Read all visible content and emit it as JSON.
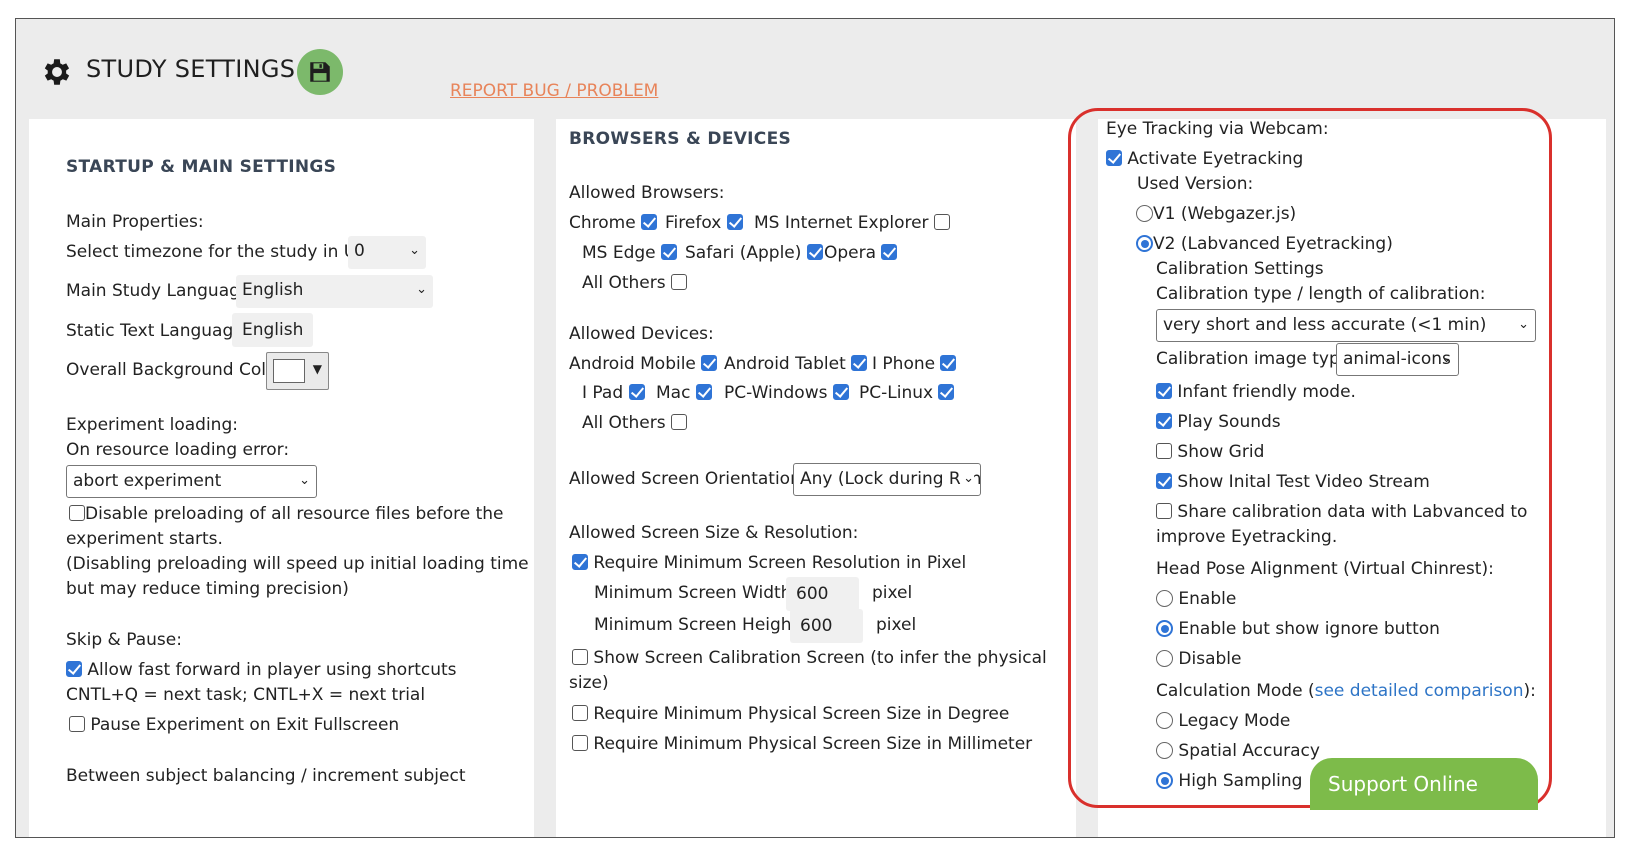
{
  "header": {
    "title": "STUDY SETTINGS",
    "report_link": "REPORT BUG / PROBLEM"
  },
  "startup": {
    "title": "STARTUP & MAIN SETTINGS",
    "main_properties_label": "Main Properties:",
    "timezone_label": "Select timezone for the study in UTC:",
    "timezone_value": "0",
    "language_label": "Main Study Language:",
    "language_value": "English",
    "static_text_label": "Static Text Language:",
    "static_text_value": "English",
    "bg_color_label": "Overall Background Color:",
    "bg_color_value": "#ffffff",
    "experiment_loading_label": "Experiment loading:",
    "resource_error_label": "On resource loading error:",
    "resource_error_value": "abort experiment",
    "disable_preload_label": "Disable preloading of all resource files before the",
    "disable_preload_label_2": "experiment starts.",
    "disable_preload_checked": false,
    "preload_note_1": "(Disabling preloading will speed up initial loading time",
    "preload_note_2": "but may reduce timing precision)",
    "skip_pause_label": "Skip & Pause:",
    "fast_forward_label": "Allow fast forward in player using shortcuts",
    "fast_forward_checked": true,
    "shortcuts_note": "CNTL+Q = next task; CNTL+X = next trial",
    "pause_exit_label": "Pause Experiment on Exit Fullscreen",
    "pause_exit_checked": false,
    "balancing_label": "Between subject balancing / increment subject"
  },
  "browsers": {
    "title": "BROWSERS & DEVICES",
    "allowed_browsers_label": "Allowed Browsers:",
    "browser_items": [
      {
        "label": "Chrome",
        "checked": true
      },
      {
        "label": "Firefox",
        "checked": true
      },
      {
        "label": "MS Internet Explorer",
        "checked": false
      },
      {
        "label": "MS Edge",
        "checked": true
      },
      {
        "label": "Safari (Apple)",
        "checked": true
      },
      {
        "label": "Opera",
        "checked": true
      },
      {
        "label": "All Others",
        "checked": false
      }
    ],
    "allowed_devices_label": "Allowed Devices:",
    "device_items": [
      {
        "label": "Android Mobile",
        "checked": true
      },
      {
        "label": "Android Tablet",
        "checked": true
      },
      {
        "label": "I Phone",
        "checked": true
      },
      {
        "label": "I Pad",
        "checked": true
      },
      {
        "label": "Mac",
        "checked": true
      },
      {
        "label": "PC-Windows",
        "checked": true
      },
      {
        "label": "PC-Linux",
        "checked": true
      },
      {
        "label": "All Others",
        "checked": false
      }
    ],
    "orientation_label": "Allowed Screen Orientations:",
    "orientation_value": "Any (Lock during Run)",
    "screen_size_label": "Allowed Screen Size & Resolution:",
    "require_min_res_label": "Require Minimum Screen Resolution in Pixel",
    "require_min_res_checked": true,
    "min_width_label": "Minimum Screen Width:",
    "min_width_value": "600",
    "min_height_label": "Minimum Screen Height:",
    "min_height_value": "600",
    "pixel_unit": "pixel",
    "show_calibration_label": "Show Screen Calibration Screen (to infer the physical",
    "show_calibration_label_2": "size)",
    "show_calibration_checked": false,
    "require_degree_label": "Require Minimum Physical Screen Size in Degree",
    "require_degree_checked": false,
    "require_mm_label": "Require Minimum Physical Screen Size in Millimeter",
    "require_mm_checked": false
  },
  "eyetracking": {
    "title": "Eye Tracking via Webcam:",
    "activate_label": "Activate Eyetracking",
    "activate_checked": true,
    "used_version_label": "Used Version:",
    "v1_label": "V1 (Webgazer.js)",
    "v1_selected": false,
    "v2_label": "V2 (Labvanced Eyetracking)",
    "v2_selected": true,
    "calibration_settings_label": "Calibration Settings",
    "calibration_type_label": "Calibration type / length of calibration:",
    "calibration_type_value": "very short and less accurate (<1 min)",
    "calibration_image_label": "Calibration image type:",
    "calibration_image_value": "animal-icons",
    "infant_label": "Infant friendly mode.",
    "infant_checked": true,
    "play_sounds_label": "Play Sounds",
    "play_sounds_checked": true,
    "show_grid_label": "Show Grid",
    "show_grid_checked": false,
    "test_video_label": "Show Inital Test Video Stream",
    "test_video_checked": true,
    "share_label": "Share calibration data with Labvanced to",
    "share_label_2": "improve Eyetracking.",
    "share_checked": false,
    "head_pose_label": "Head Pose Alignment (Virtual Chinrest):",
    "head_pose_options": [
      {
        "label": "Enable",
        "selected": false
      },
      {
        "label": "Enable but show ignore button",
        "selected": true
      },
      {
        "label": "Disable",
        "selected": false
      }
    ],
    "calc_mode_prefix": "Calculation Mode (",
    "calc_mode_link": "see detailed comparison",
    "calc_mode_suffix": "):",
    "calc_mode_options": [
      {
        "label": "Legacy Mode",
        "selected": false
      },
      {
        "label": "Spatial Accuracy",
        "selected": false
      },
      {
        "label": "High Sampling",
        "selected": true
      }
    ]
  },
  "support_button": "Support Online",
  "colors": {
    "accent": "#2f74d6",
    "report_link": "#e8845a",
    "save_green": "#7cb96b",
    "support_green": "#7dbb4a",
    "highlight_red": "#d9302c"
  }
}
